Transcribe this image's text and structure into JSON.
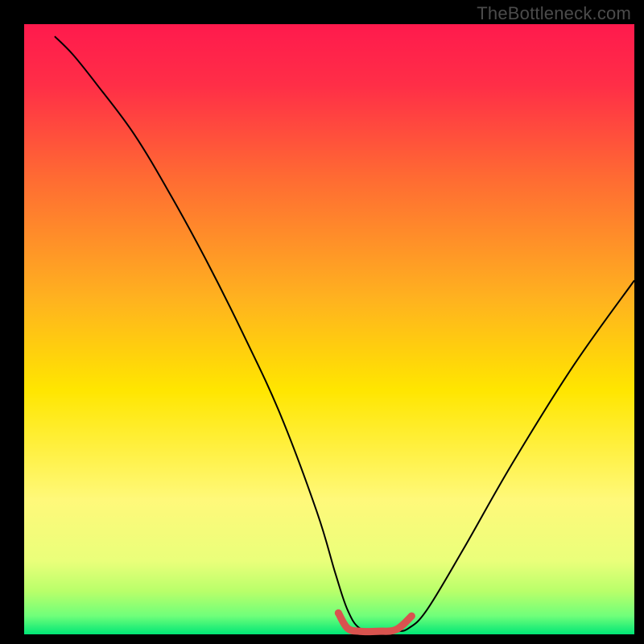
{
  "watermark": "TheBottleneck.com",
  "chart_data": {
    "type": "line",
    "title": "",
    "xlabel": "",
    "ylabel": "",
    "xlim": [
      0,
      100
    ],
    "ylim": [
      0,
      100
    ],
    "background": {
      "type": "vertical-gradient",
      "stops": [
        {
          "offset": 0.0,
          "color": "#ff1a4d"
        },
        {
          "offset": 0.1,
          "color": "#ff2e47"
        },
        {
          "offset": 0.25,
          "color": "#ff6a33"
        },
        {
          "offset": 0.45,
          "color": "#ffb21f"
        },
        {
          "offset": 0.6,
          "color": "#ffe600"
        },
        {
          "offset": 0.78,
          "color": "#fff97a"
        },
        {
          "offset": 0.88,
          "color": "#eaff7a"
        },
        {
          "offset": 0.93,
          "color": "#b8ff6a"
        },
        {
          "offset": 0.97,
          "color": "#6fff7a"
        },
        {
          "offset": 1.0,
          "color": "#00e676"
        }
      ]
    },
    "series": [
      {
        "name": "bottleneck-curve",
        "color": "#000000",
        "stroke_width": 2,
        "x": [
          5,
          8,
          12,
          18,
          24,
          30,
          36,
          42,
          48,
          51,
          53,
          55,
          58,
          61,
          63,
          66,
          72,
          80,
          90,
          100
        ],
        "y": [
          98,
          95,
          90,
          82,
          72,
          61,
          49,
          36,
          20,
          10,
          4,
          1,
          0.5,
          0.5,
          1,
          4,
          14,
          28,
          44,
          58
        ]
      },
      {
        "name": "optimal-zone",
        "color": "#d9534f",
        "stroke_width": 9,
        "linecap": "round",
        "x": [
          51.5,
          53,
          55,
          58,
          61,
          63.5
        ],
        "y": [
          3.5,
          1.0,
          0.5,
          0.5,
          0.8,
          3.0
        ]
      }
    ],
    "annotations": []
  }
}
